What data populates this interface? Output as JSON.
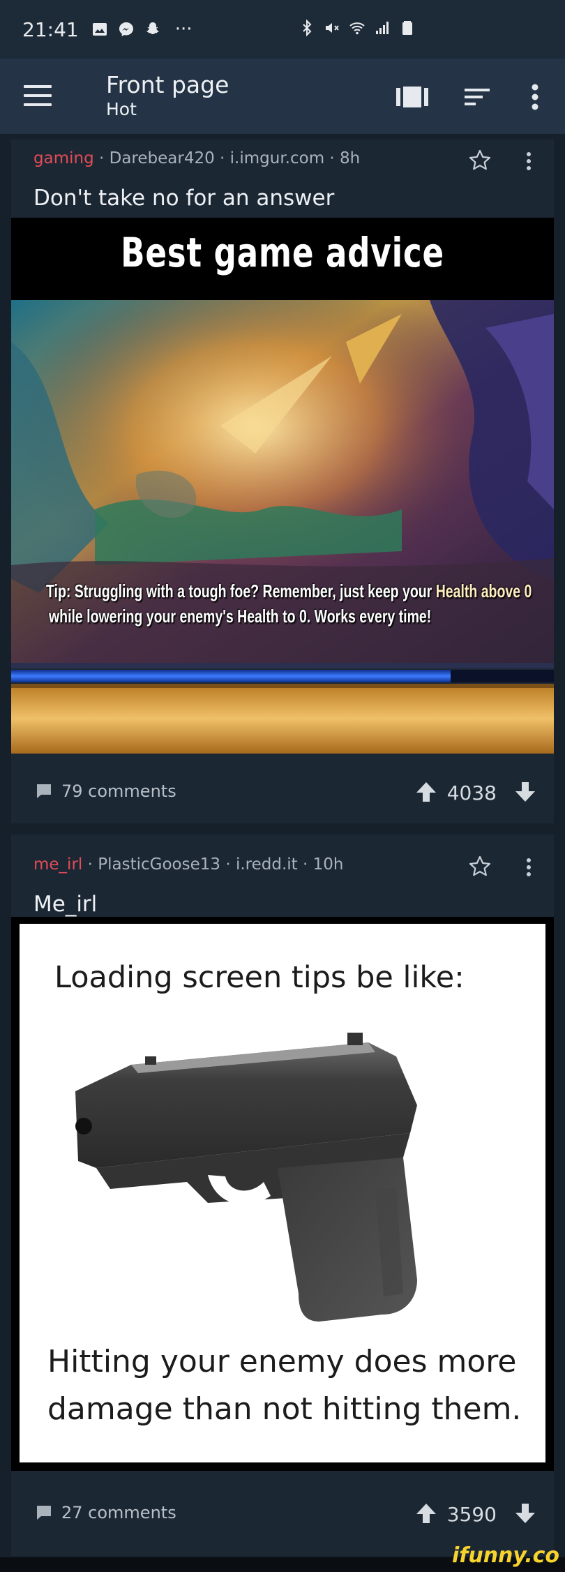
{
  "status_bar": {
    "time": "21:41",
    "left_icons": [
      "gallery-icon",
      "messenger-icon",
      "snapchat-icon",
      "more-notifications-icon"
    ],
    "more_dots": "···",
    "right_icons": [
      "bluetooth-icon",
      "mute-icon",
      "wifi-icon",
      "signal-icon",
      "battery-icon"
    ]
  },
  "app_bar": {
    "title": "Front page",
    "subtitle": "Hot",
    "actions": [
      "view-mode-icon",
      "sort-icon",
      "overflow-menu-icon"
    ]
  },
  "posts": [
    {
      "subreddit": "gaming",
      "author": "Darebear420",
      "domain": "i.imgur.com",
      "age": "8h",
      "separator": "·",
      "title": "Don't take no for an answer",
      "image": {
        "header": "Best game advice",
        "tip_line_1_a": "Tip: Struggling with a tough foe? Remember, just keep your ",
        "tip_line_1_b": "Health above 0",
        "tip_line_2": "while lowering your enemy's Health to 0. Works every time!"
      },
      "comments": "79 comments",
      "score": "4038"
    },
    {
      "subreddit": "me_irl",
      "author": "PlasticGoose13",
      "domain": "i.redd.it",
      "age": "10h",
      "separator": "·",
      "title": "Me_irl",
      "image": {
        "caption_top": "Loading screen tips be like:",
        "caption_bottom": "Hitting your enemy does more damage than not hitting them."
      },
      "comments": "27 comments",
      "score": "3590"
    }
  ],
  "watermark": "ifunny.co",
  "colors": {
    "background": "#16202b",
    "app_bar": "#243446",
    "card": "#1c2734",
    "subreddit": "#e24c56"
  }
}
